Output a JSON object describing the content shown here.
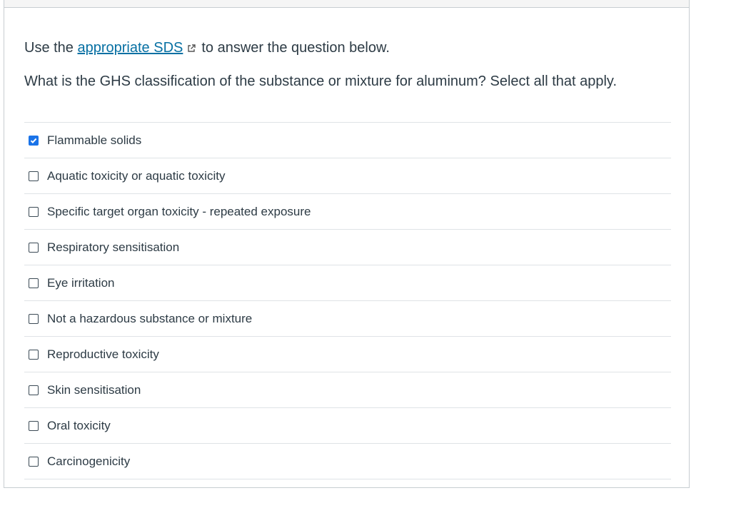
{
  "intro": {
    "before": "Use the",
    "link_text": "appropriate SDS",
    "after": "to answer the question below."
  },
  "question": "What is the GHS classification of the substance or mixture for aluminum? Select all that apply.",
  "colors": {
    "link": "#0770a3",
    "checkbox_checked": "#1a73e8",
    "text": "#2d3b45"
  },
  "answers": [
    {
      "label": "Flammable solids",
      "checked": true
    },
    {
      "label": "Aquatic toxicity or aquatic toxicity",
      "checked": false
    },
    {
      "label": "Specific target organ toxicity - repeated exposure",
      "checked": false
    },
    {
      "label": "Respiratory sensitisation",
      "checked": false
    },
    {
      "label": "Eye irritation",
      "checked": false
    },
    {
      "label": "Not a hazardous substance or mixture",
      "checked": false
    },
    {
      "label": "Reproductive toxicity",
      "checked": false
    },
    {
      "label": "Skin sensitisation",
      "checked": false
    },
    {
      "label": "Oral toxicity",
      "checked": false
    },
    {
      "label": "Carcinogenicity",
      "checked": false
    }
  ]
}
